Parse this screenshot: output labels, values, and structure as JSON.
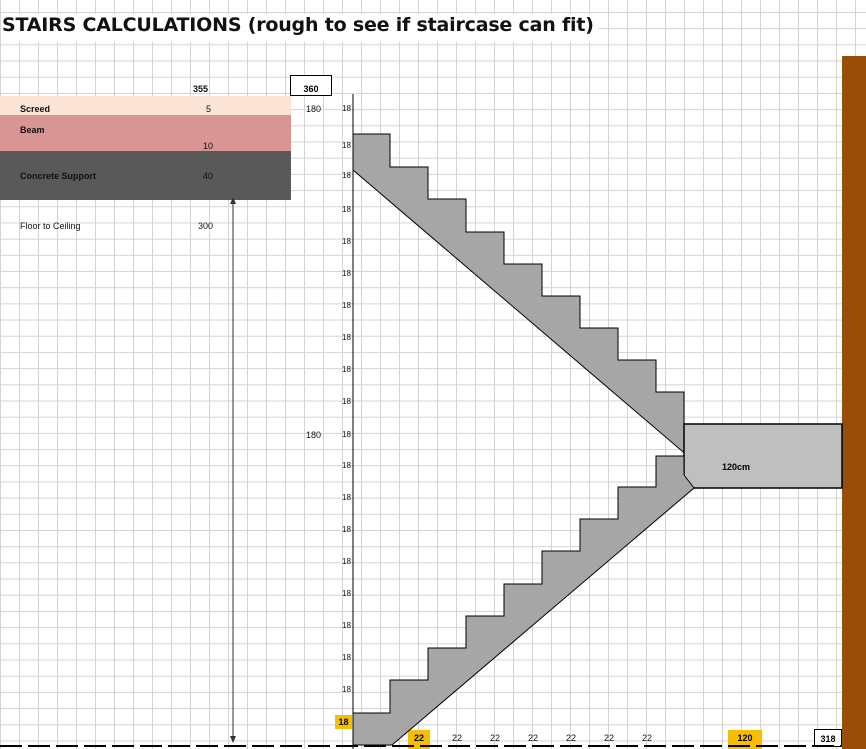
{
  "title": "STAIRS CALCULATIONS  (rough to see if staircase can fit)",
  "header": {
    "total_a": "355",
    "total_b": "360"
  },
  "layers": [
    {
      "label": "Screed",
      "value": "5",
      "color": "#fbe3d5"
    },
    {
      "label": "Beam",
      "value": "10",
      "color": "#d99594"
    },
    {
      "label": "Concrete Support",
      "value": "40",
      "color": "#595959"
    }
  ],
  "floor_to_ceiling": {
    "label": "Floor to Ceiling",
    "value": "300"
  },
  "half_heights": [
    "180",
    "180"
  ],
  "riser_values": [
    "18",
    "18",
    "18",
    "18",
    "18",
    "18",
    "18",
    "18",
    "18",
    "18",
    "18",
    "18",
    "18",
    "18",
    "18",
    "18",
    "18",
    "18",
    "18"
  ],
  "highlighted_riser": "18",
  "tread_values": [
    "22",
    "22",
    "22",
    "22",
    "22",
    "22",
    "22",
    "22"
  ],
  "landing": {
    "label": "120cm",
    "value": "120"
  },
  "total_run": "318",
  "colors": {
    "stairs": "#a6a6a6",
    "landing": "#bfbfbf",
    "wall": "#9a4d06",
    "highlight": "#f7bd00"
  }
}
